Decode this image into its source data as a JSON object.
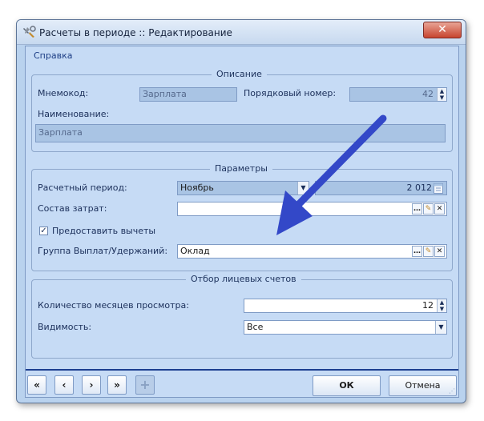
{
  "window": {
    "title": "Расчеты в периоде :: Редактирование",
    "close_glyph": "✕"
  },
  "menu": {
    "help": "Справка"
  },
  "description": {
    "legend": "Описание",
    "mnemocode_label": "Мнемокод:",
    "mnemocode_value": "Зарплата",
    "order_label": "Порядковый номер:",
    "order_value": "42",
    "name_label": "Наименование:",
    "name_value": "Зарплата"
  },
  "parameters": {
    "legend": "Параметры",
    "period_label": "Расчетный период:",
    "period_month": "Ноябрь",
    "period_year": "2 012",
    "costs_label": "Состав затрат:",
    "costs_value": "",
    "deductions_label": "Предоставить вычеты",
    "deductions_checked": true,
    "group_label": "Группа Выплат/Удержаний:",
    "group_value": "Оклад"
  },
  "accounts": {
    "legend": "Отбор лицевых счетов",
    "months_label": "Количество месяцев просмотра:",
    "months_value": "12",
    "visibility_label": "Видимость:",
    "visibility_value": "Все"
  },
  "navigation": {
    "first": "«",
    "prev": "‹",
    "next": "›",
    "last": "»",
    "add": "+"
  },
  "buttons": {
    "ok": "ОК",
    "cancel": "Отмена"
  },
  "icons": {
    "app": "tools-icon",
    "ellipsis": "…",
    "edit": "✎",
    "clear": "✕",
    "check": "✓",
    "dropdown": "▼",
    "spin_up": "▲",
    "spin_down": "▼"
  },
  "colors": {
    "accent": "#1d3f91",
    "arrow": "#3348c8",
    "close": "#c7442f"
  }
}
